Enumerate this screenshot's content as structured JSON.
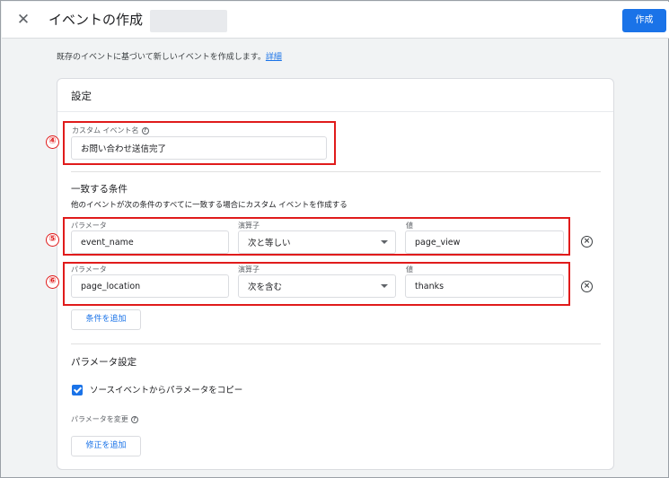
{
  "header": {
    "close_icon": "close-icon",
    "title": "イベントの作成",
    "create_label": "作成"
  },
  "description": {
    "text": "既存のイベントに基づいて新しいイベントを作成します。",
    "link": "詳細"
  },
  "card": {
    "title": "設定",
    "custom_event": {
      "label": "カスタム イベント名",
      "value": "お問い合わせ送信完了"
    },
    "conditions": {
      "heading": "一致する条件",
      "subtext": "他のイベントが次の条件のすべてに一致する場合にカスタム イベントを作成する",
      "param_label": "パラメータ",
      "operator_label": "演算子",
      "value_label": "値",
      "rows": [
        {
          "parameter": "event_name",
          "operator": "次と等しい",
          "value": "page_view"
        },
        {
          "parameter": "page_location",
          "operator": "次を含む",
          "value": "thanks"
        }
      ],
      "add_label": "条件を追加"
    },
    "param_settings": {
      "heading": "パラメータ設定",
      "copy_label": "ソースイベントからパラメータをコピー",
      "modify_label": "パラメータを変更",
      "add_modification_label": "修正を追加"
    }
  },
  "annotations": {
    "n4": "④",
    "n5": "⑤",
    "n6": "⑥",
    "color": "#e01b1b"
  },
  "colors": {
    "accent": "#1a73e8",
    "background": "#f1f3f4"
  }
}
